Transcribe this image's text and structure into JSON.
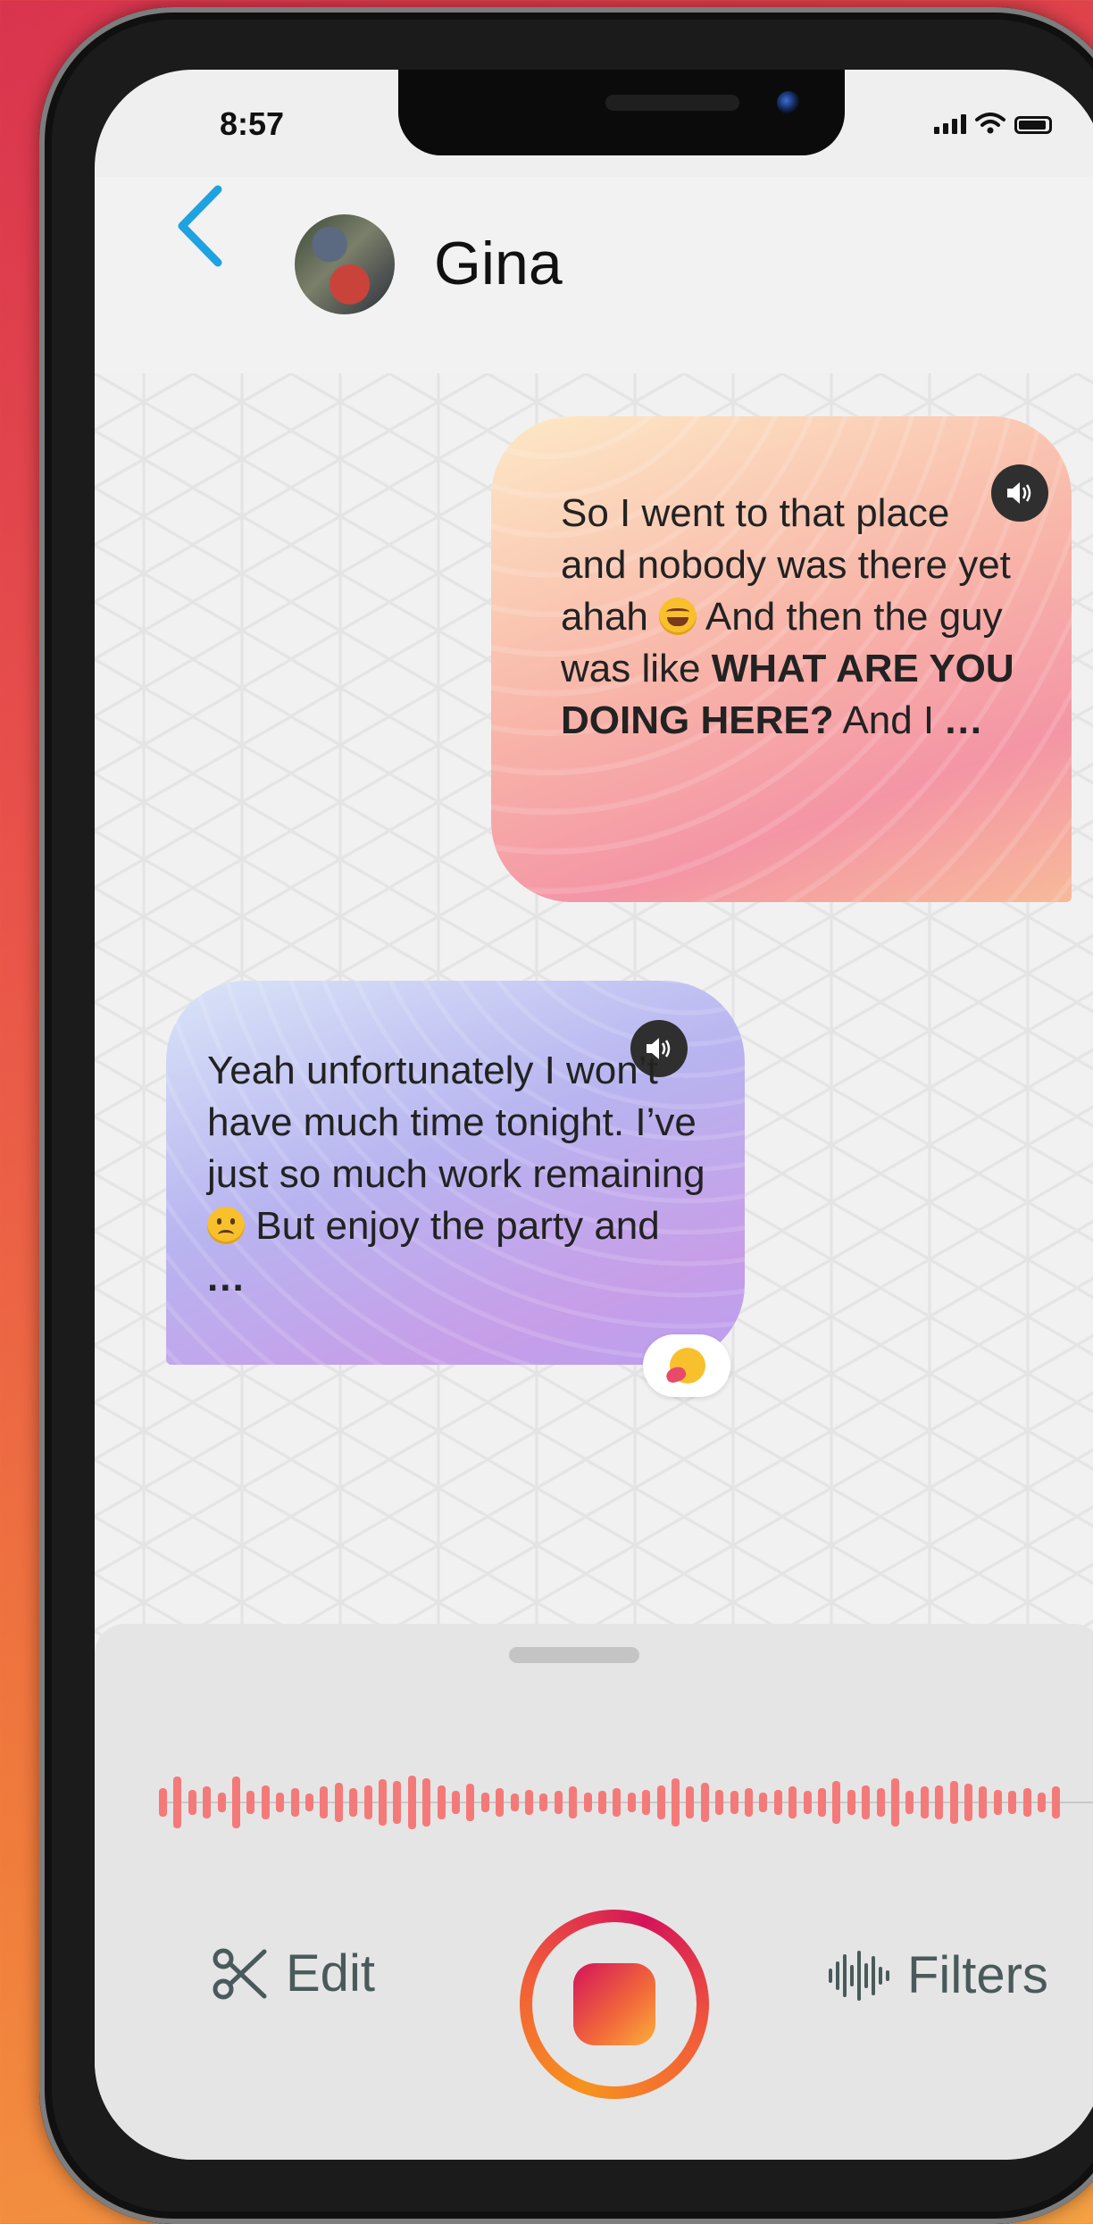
{
  "status_bar": {
    "time": "8:57"
  },
  "header": {
    "contact_name": "Gina"
  },
  "messages": [
    {
      "direction": "outgoing",
      "text_1": "So I went to that place and nobody was there yet ahah",
      "emoji": "laughing-emoji",
      "text_2": " And then the guy was like ",
      "bold": "WHAT ARE YOU DOING HERE?",
      "text_3": " And I ",
      "ellipsis": "..."
    },
    {
      "direction": "incoming",
      "text_1": "Yeah unfortunately I won’t have much time tonight. I’ve just so much work remaining ",
      "emoji": "sad-emoji",
      "text_2": " But enjoy the party and ",
      "ellipsis": "...",
      "reaction": "hug-emoji"
    }
  ],
  "recorder": {
    "waveform_levels": [
      0.5,
      0.9,
      0.45,
      0.55,
      0.35,
      0.9,
      0.4,
      0.6,
      0.35,
      0.5,
      0.3,
      0.55,
      0.7,
      0.5,
      0.6,
      0.8,
      0.75,
      0.95,
      0.85,
      0.6,
      0.4,
      0.65,
      0.35,
      0.5,
      0.3,
      0.45,
      0.3,
      0.4,
      0.55,
      0.35,
      0.4,
      0.5,
      0.35,
      0.45,
      0.6,
      0.85,
      0.55,
      0.7,
      0.45,
      0.4,
      0.5,
      0.35,
      0.45,
      0.55,
      0.4,
      0.5,
      0.75,
      0.45,
      0.6,
      0.5,
      0.85,
      0.4,
      0.55,
      0.6,
      0.75,
      0.65,
      0.55,
      0.45,
      0.4,
      0.5,
      0.35,
      0.55
    ],
    "edit_label": "Edit",
    "filters_label": "Filters",
    "accent_color": "#f47a7a"
  }
}
